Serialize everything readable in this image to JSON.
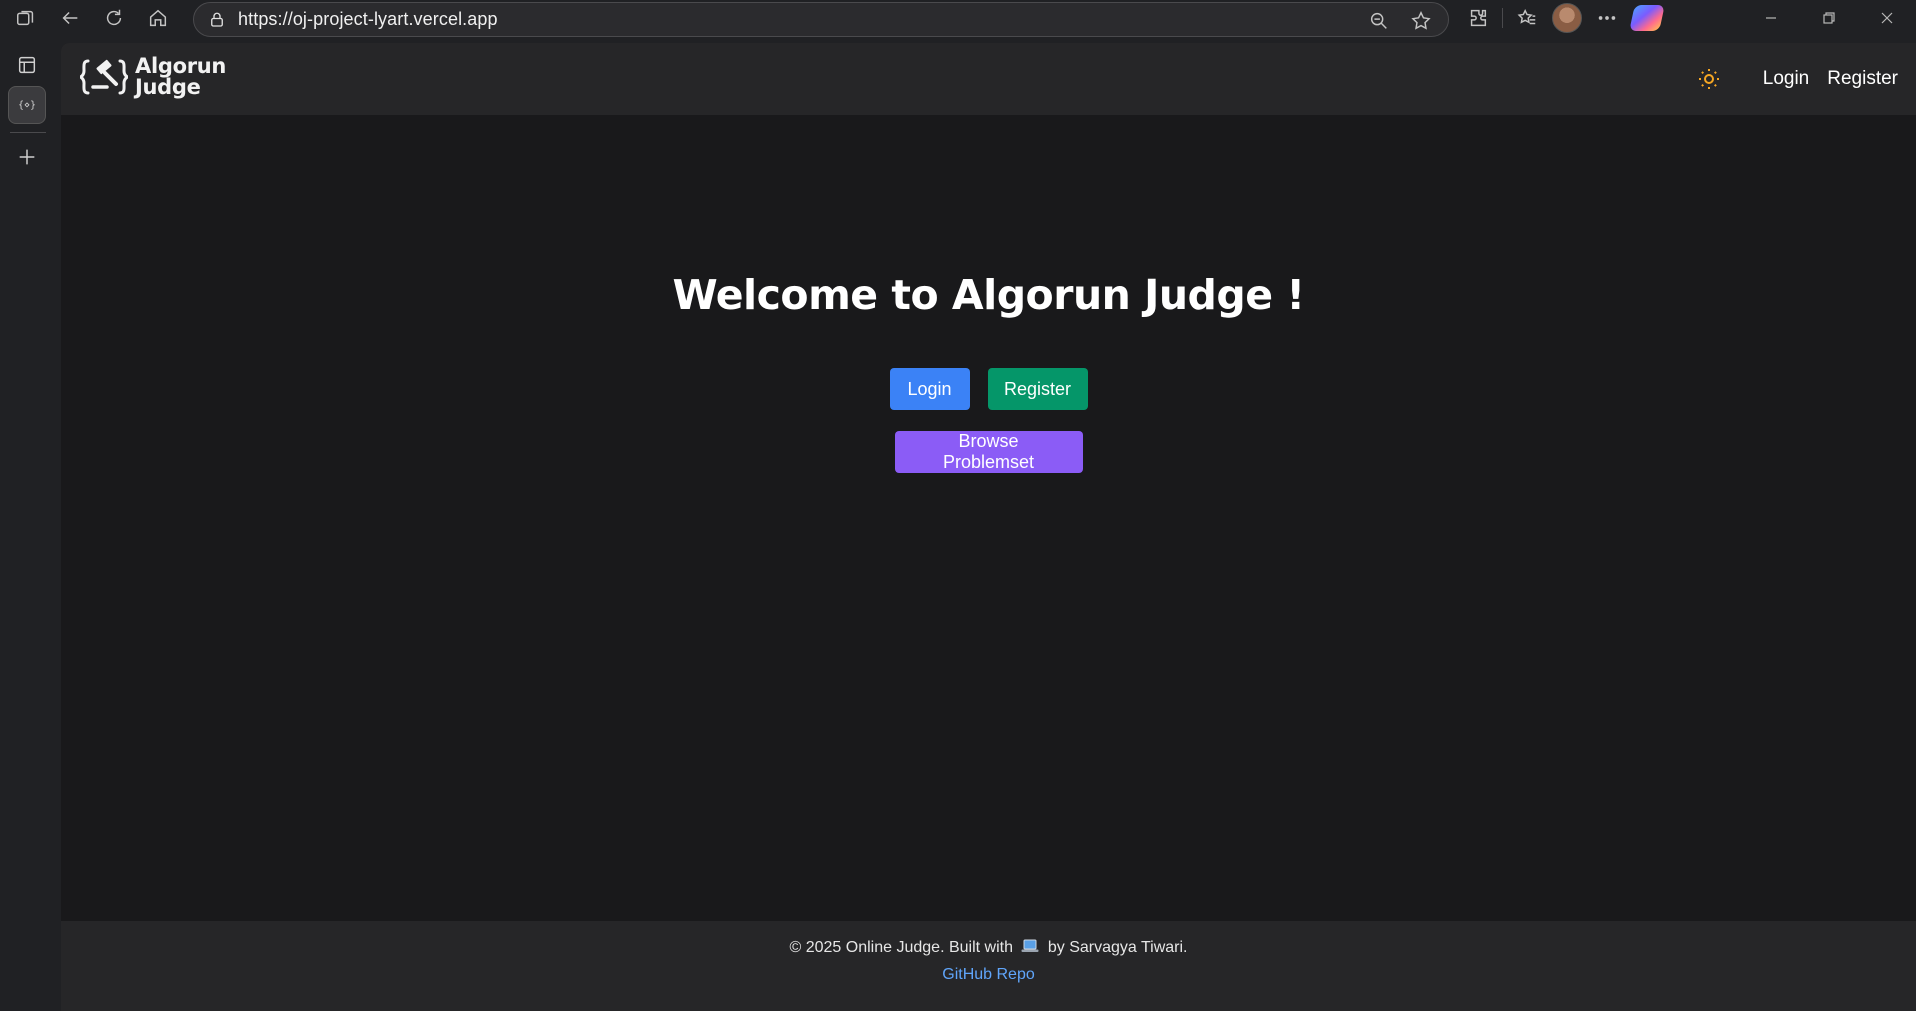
{
  "browser": {
    "url": "https://oj-project-lyart.vercel.app",
    "tab_favicon_text": "{⋄}"
  },
  "header": {
    "brand_line1": "Algorun",
    "brand_line2": "Judge",
    "login_label": "Login",
    "register_label": "Register"
  },
  "hero": {
    "title": "Welcome to Algorun Judge !",
    "login_label": "Login",
    "register_label": "Register",
    "browse_label": "Browse Problemset"
  },
  "footer": {
    "text_before": "© 2025 Online Judge. Built with",
    "text_after": "by Sarvagya Tiwari.",
    "link_label": "GitHub Repo"
  },
  "colors": {
    "login_button": "#3b82f6",
    "register_button": "#059669",
    "browse_button": "#8b5cf6",
    "theme_icon": "#f5a623",
    "footer_link": "#60a5fa"
  }
}
